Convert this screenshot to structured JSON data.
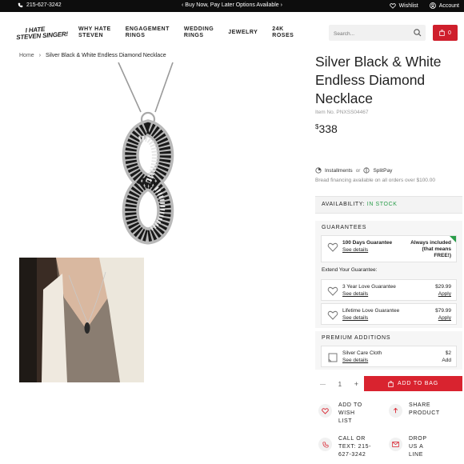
{
  "topbar": {
    "phone": "215-627-3242",
    "promo": "Buy Now, Pay Later Options Available",
    "wishlist": "Wishlist",
    "account": "Account"
  },
  "nav": {
    "logo_line1": "I HATE",
    "logo_line2": "STEVEN SINGER!",
    "links": [
      {
        "l1": "WHY HATE",
        "l2": "STEVEN"
      },
      {
        "l1": "ENGAGEMENT",
        "l2": "RINGS"
      },
      {
        "l1": "WEDDING",
        "l2": "RINGS"
      },
      {
        "l1": "JEWELRY",
        "l2": ""
      },
      {
        "l1": "24K",
        "l2": "ROSES"
      }
    ],
    "search_placeholder": "Search...",
    "cart_count": "0"
  },
  "breadcrumb": {
    "home": "Home",
    "sep": "›",
    "current": "Silver Black & White Endless Diamond Necklace"
  },
  "product": {
    "title_lines": [
      "Silver Black & White",
      "Endless Diamond",
      "Necklace"
    ],
    "item_no": "Item No. PNXSS04467",
    "price_symbol": "$",
    "price": "338",
    "installments": "Installments",
    "or": "or",
    "splitpay": "SplitPay",
    "bread_note": "Bread financing available on all orders over $100.00"
  },
  "availability": {
    "label": "AVAILABILITY:",
    "status": "IN STOCK",
    "status_color": "#2a9d4a"
  },
  "guarantees": {
    "header": "GUARANTEES",
    "included": {
      "name": "100 Days Guarantee",
      "details": "See details",
      "note_lines": [
        "Always included",
        "(that means",
        "FREE!)"
      ]
    },
    "extend_label": "Extend Your Guarantee:",
    "options": [
      {
        "name": "3 Year Love Guarantee",
        "details": "See details",
        "price": "$29.99",
        "action": "Apply"
      },
      {
        "name": "Lifetime Love Guarantee",
        "details": "See details",
        "price": "$79.99",
        "action": "Apply"
      }
    ]
  },
  "premium": {
    "header": "PREMIUM ADDITIONS",
    "item": {
      "name": "Silver Care Cloth",
      "details": "See details",
      "price": "$2",
      "action": "Add"
    }
  },
  "cart": {
    "minus": "—",
    "quantity": "1",
    "plus": "+",
    "add_label": "ADD TO BAG",
    "accent": "#d9232f"
  },
  "actions": [
    {
      "lines": [
        "ADD TO",
        "WISH",
        "LIST"
      ],
      "icon": "heart-icon"
    },
    {
      "lines": [
        "SHARE",
        "PRODUCT"
      ],
      "icon": "share-icon"
    },
    {
      "lines": [
        "CALL OR",
        "TEXT: 215-",
        "627-3242"
      ],
      "icon": "phone-icon"
    },
    {
      "lines": [
        "DROP",
        "US A",
        "LINE"
      ],
      "icon": "mail-icon"
    }
  ]
}
